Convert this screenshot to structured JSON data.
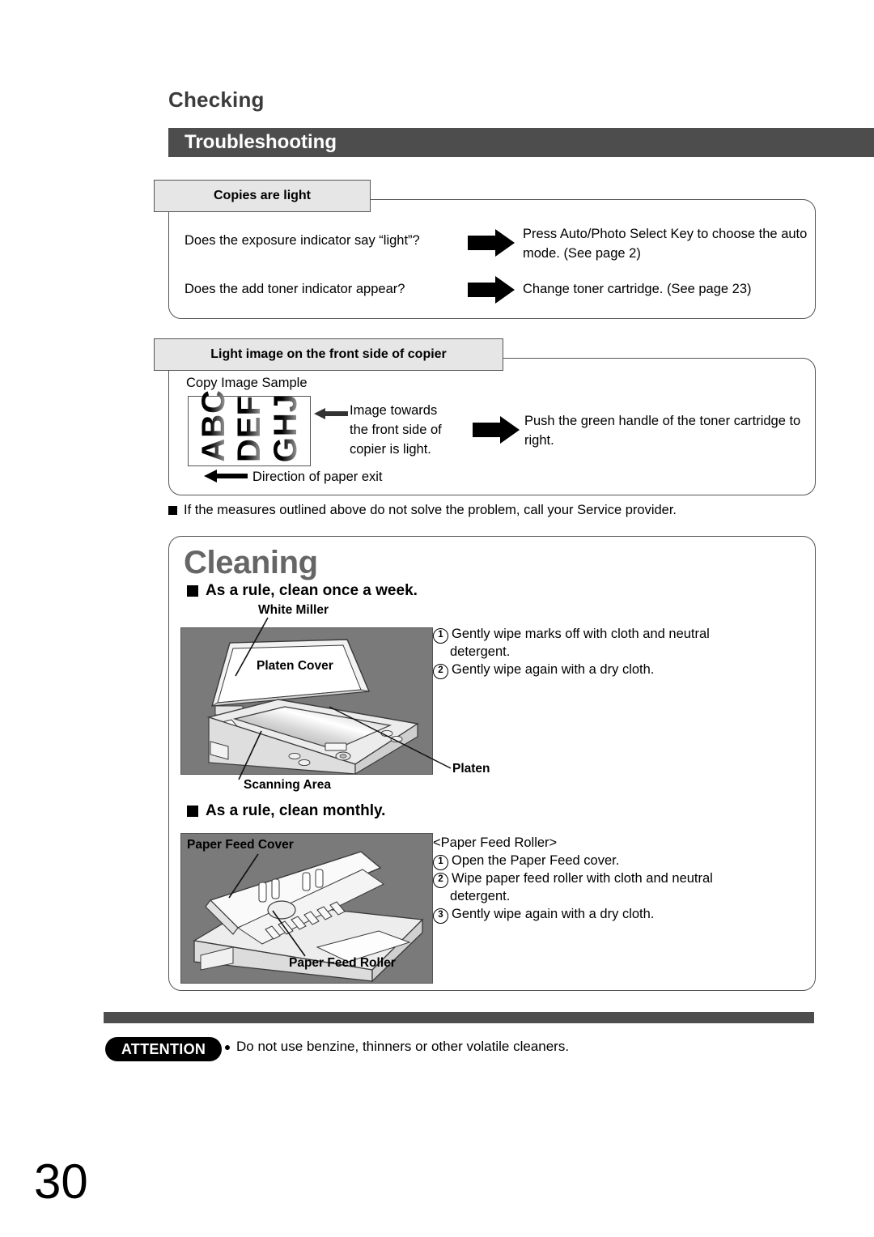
{
  "header": {
    "checking": "Checking",
    "section": "Troubleshooting"
  },
  "troubleshooting": {
    "box1": {
      "tab": "Copies are light",
      "rows": [
        {
          "question": "Does the exposure indicator say “light”?",
          "arrow": "right-block-arrow-icon",
          "answer": "Press Auto/Photo Select Key to choose the auto mode. (See page 2)"
        },
        {
          "question": "Does the add toner indicator appear?",
          "arrow": "right-block-arrow-icon",
          "answer": "Change toner cartridge. (See page 23)"
        }
      ]
    },
    "box2": {
      "tab": "Light image on the front side of copier",
      "sample_caption": "Copy Image Sample",
      "sample_columns": [
        "ABC",
        "DEF",
        "GHJ"
      ],
      "callout": "Image towards the front side of copier is light.",
      "arrow": "right-block-arrow-icon",
      "action": "Push the green handle of the toner cartridge to right.",
      "paper_exit": "Direction of paper exit"
    },
    "footnote": "If the measures outlined above do not solve the problem, call your Service provider."
  },
  "cleaning": {
    "title": "Cleaning",
    "weekly": {
      "rule": "As a rule, clean once a week.",
      "labels": {
        "white_miller": "White Miller",
        "platen_cover": "Platen Cover",
        "platen": "Platen",
        "scanning_area": "Scanning Area"
      },
      "steps": [
        {
          "num": "1",
          "text": "Gently wipe marks off with cloth and neutral",
          "cont": "detergent."
        },
        {
          "num": "2",
          "text": "Gently wipe again with a dry cloth.",
          "cont": ""
        }
      ]
    },
    "monthly": {
      "rule": "As a rule, clean monthly.",
      "heading": "<Paper Feed Roller>",
      "labels": {
        "paper_feed_cover": "Paper Feed Cover",
        "paper_feed_roller": "Paper Feed Roller"
      },
      "steps": [
        {
          "num": "1",
          "text": "Open the Paper Feed cover.",
          "cont": ""
        },
        {
          "num": "2",
          "text": "Wipe paper feed roller with cloth and neutral",
          "cont": "detergent."
        },
        {
          "num": "3",
          "text": "Gently wipe again with a dry cloth.",
          "cont": ""
        }
      ]
    }
  },
  "attention": {
    "label": "ATTENTION",
    "text": "Do not use benzine, thinners or other volatile cleaners."
  },
  "page_number": "30",
  "colors": {
    "band": "#4d4d4d",
    "tab_fill": "#e6e6e6",
    "cleaning_title": "#666666",
    "illustration_bg": "#7a7a7a"
  }
}
